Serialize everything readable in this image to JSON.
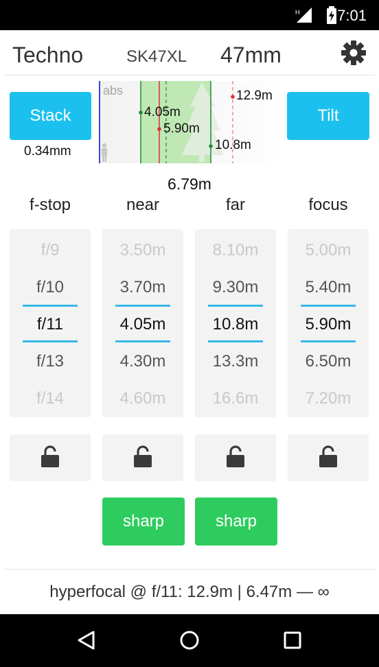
{
  "status": {
    "time": "7:01"
  },
  "appbar": {
    "name": "Techno",
    "lens": "SK47XL",
    "focal": "47mm"
  },
  "controls": {
    "stack_label": "Stack",
    "stack_value": "0.34mm",
    "tilt_label": "Tilt",
    "dof_value": "6.79m"
  },
  "scene": {
    "abs_label": "abs",
    "near_marker": "4.05m",
    "focus_marker": "5.90m",
    "far_marker": "10.8m",
    "hyperfocal_marker": "12.9m"
  },
  "columns": [
    {
      "header": "f-stop",
      "options": [
        "f/9",
        "f/10",
        "f/11",
        "f/13",
        "f/14"
      ]
    },
    {
      "header": "near",
      "options": [
        "3.50m",
        "3.70m",
        "4.05m",
        "4.30m",
        "4.60m"
      ]
    },
    {
      "header": "far",
      "options": [
        "8.10m",
        "9.30m",
        "10.8m",
        "13.3m",
        "16.6m"
      ]
    },
    {
      "header": "focus",
      "options": [
        "5.00m",
        "5.40m",
        "5.90m",
        "6.50m",
        "7.20m"
      ]
    }
  ],
  "sharp": {
    "near_label": "sharp",
    "far_label": "sharp"
  },
  "footer": {
    "text": "hyperfocal @ f/11: 12.9m | 6.47m — ∞"
  },
  "icons": {
    "settings": "gear-icon",
    "lock": "lock-open-icon",
    "back": "back-triangle-icon",
    "home": "home-circle-icon",
    "recents": "recents-square-icon"
  },
  "colors": {
    "accent_blue": "#1cc0ee",
    "sharp_green": "#2ecc5e",
    "selection_rule": "#35b8e8",
    "dof_zone": "#bfe8b4"
  }
}
